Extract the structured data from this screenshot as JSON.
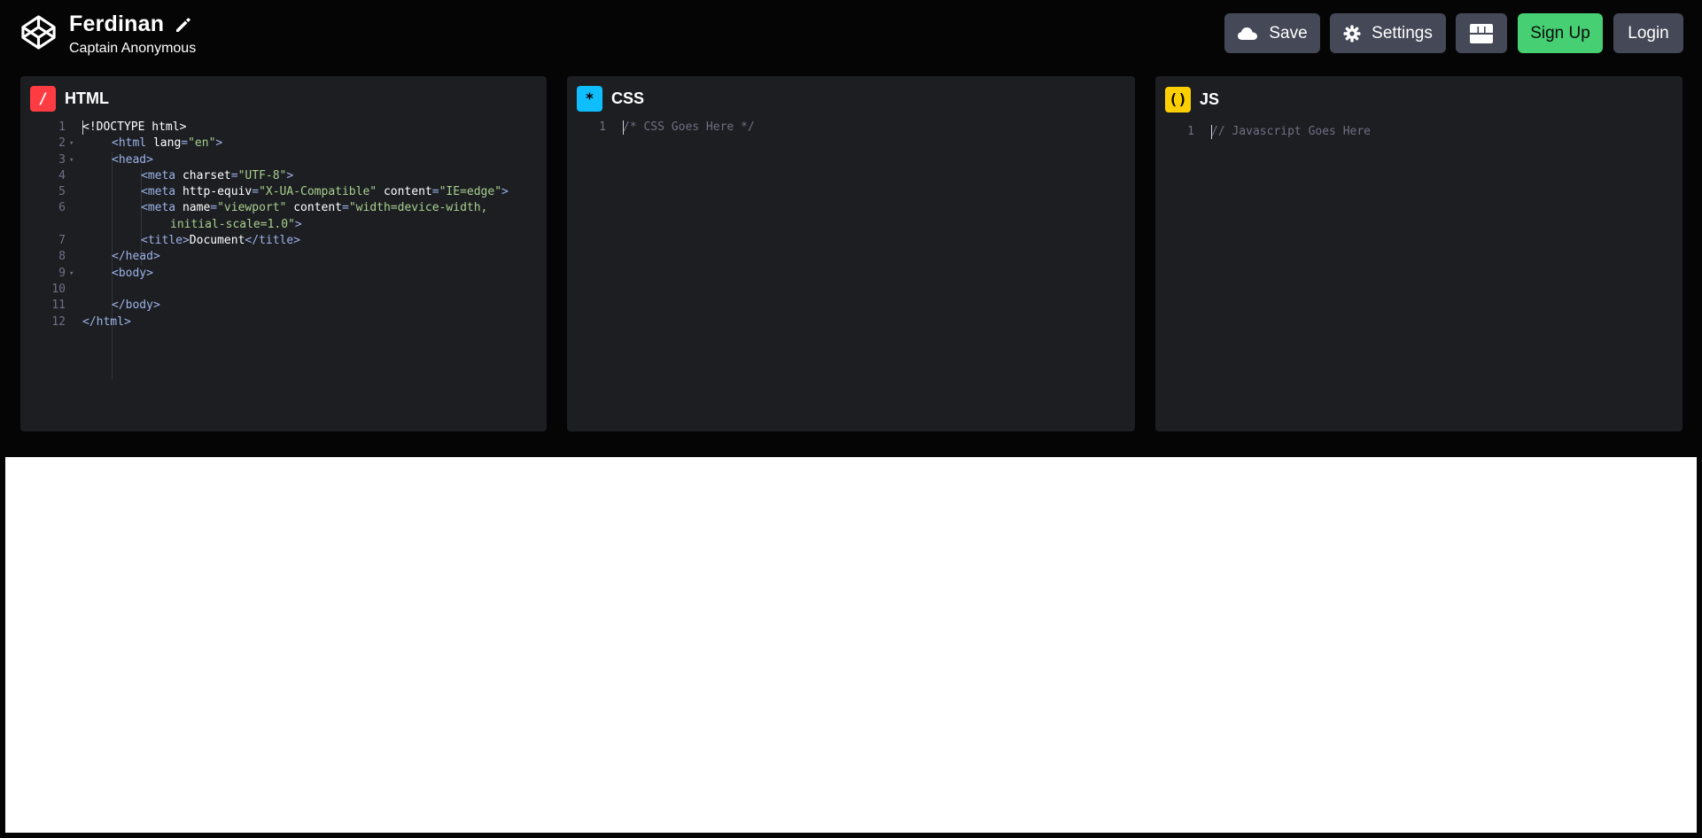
{
  "header": {
    "title": "Ferdinan",
    "subtitle": "Captain Anonymous",
    "buttons": {
      "save": "Save",
      "settings": "Settings",
      "signup": "Sign Up",
      "login": "Login"
    },
    "icons": {
      "logo": "codepen-logo-icon",
      "edit": "pencil-icon",
      "save": "cloud-icon",
      "settings": "gear-icon",
      "layout": "layout-icon"
    }
  },
  "editors": {
    "html": {
      "label": "HTML",
      "badge": "/",
      "badge_color": "#ff3c41",
      "lines": [
        {
          "n": "1",
          "fold": false,
          "indent": 0,
          "tokens": [
            {
              "c": "tx",
              "t": "<!DOCTYPE html>"
            }
          ]
        },
        {
          "n": "2",
          "fold": true,
          "indent": 1,
          "tokens": [
            {
              "c": "tag",
              "t": "<html"
            },
            {
              "c": "attr",
              "t": " lang"
            },
            {
              "c": "tag",
              "t": "="
            },
            {
              "c": "str",
              "t": "\"en\""
            },
            {
              "c": "tag",
              "t": ">"
            }
          ]
        },
        {
          "n": "3",
          "fold": true,
          "indent": 1,
          "tokens": [
            {
              "c": "tag",
              "t": "<head>"
            }
          ]
        },
        {
          "n": "4",
          "fold": false,
          "indent": 2,
          "tokens": [
            {
              "c": "tag",
              "t": "<meta"
            },
            {
              "c": "attr",
              "t": " charset"
            },
            {
              "c": "tag",
              "t": "="
            },
            {
              "c": "str",
              "t": "\"UTF-8\""
            },
            {
              "c": "tag",
              "t": ">"
            }
          ]
        },
        {
          "n": "5",
          "fold": false,
          "indent": 2,
          "tokens": [
            {
              "c": "tag",
              "t": "<meta"
            },
            {
              "c": "attr",
              "t": " http-equiv"
            },
            {
              "c": "tag",
              "t": "="
            },
            {
              "c": "str",
              "t": "\"X-UA-Compatible\""
            },
            {
              "c": "attr",
              "t": " content"
            },
            {
              "c": "tag",
              "t": "="
            },
            {
              "c": "str",
              "t": "\"IE=edge\""
            },
            {
              "c": "tag",
              "t": ">"
            }
          ]
        },
        {
          "n": "6",
          "fold": false,
          "indent": 2,
          "tokens": [
            {
              "c": "tag",
              "t": "<meta"
            },
            {
              "c": "attr",
              "t": " name"
            },
            {
              "c": "tag",
              "t": "="
            },
            {
              "c": "str",
              "t": "\"viewport\""
            },
            {
              "c": "attr",
              "t": " content"
            },
            {
              "c": "tag",
              "t": "="
            },
            {
              "c": "str",
              "t": "\"width=device-width,"
            }
          ]
        },
        {
          "n": "",
          "fold": false,
          "indent": 3,
          "tokens": [
            {
              "c": "str",
              "t": "initial-scale=1.0\""
            },
            {
              "c": "tag",
              "t": ">"
            }
          ]
        },
        {
          "n": "7",
          "fold": false,
          "indent": 2,
          "tokens": [
            {
              "c": "tag",
              "t": "<title>"
            },
            {
              "c": "tx",
              "t": "Document"
            },
            {
              "c": "tag",
              "t": "</title>"
            }
          ]
        },
        {
          "n": "8",
          "fold": false,
          "indent": 1,
          "tokens": [
            {
              "c": "tag",
              "t": "</head>"
            }
          ]
        },
        {
          "n": "9",
          "fold": true,
          "indent": 1,
          "tokens": [
            {
              "c": "tag",
              "t": "<body>"
            }
          ]
        },
        {
          "n": "10",
          "fold": false,
          "indent": 1,
          "tokens": []
        },
        {
          "n": "11",
          "fold": false,
          "indent": 1,
          "tokens": [
            {
              "c": "tag",
              "t": "</body>"
            }
          ]
        },
        {
          "n": "12",
          "fold": false,
          "indent": 0,
          "tokens": [
            {
              "c": "tag",
              "t": "</html>"
            }
          ]
        }
      ]
    },
    "css": {
      "label": "CSS",
      "badge": "*",
      "badge_color": "#0ebeff",
      "lines": [
        {
          "n": "1",
          "fold": false,
          "indent": 0,
          "tokens": [
            {
              "c": "comment",
              "t": "/* CSS Goes Here */"
            }
          ]
        }
      ]
    },
    "js": {
      "label": "JS",
      "badge": "()",
      "badge_color": "#fcd000",
      "lines": [
        {
          "n": "1",
          "fold": false,
          "indent": 0,
          "tokens": [
            {
              "c": "comment",
              "t": "// Javascript Goes Here"
            }
          ]
        }
      ]
    }
  },
  "colors": {
    "background": "#050505",
    "panel": "#1d1e22",
    "button": "#444857",
    "signup": "#47cf73",
    "preview": "#ffffff"
  }
}
